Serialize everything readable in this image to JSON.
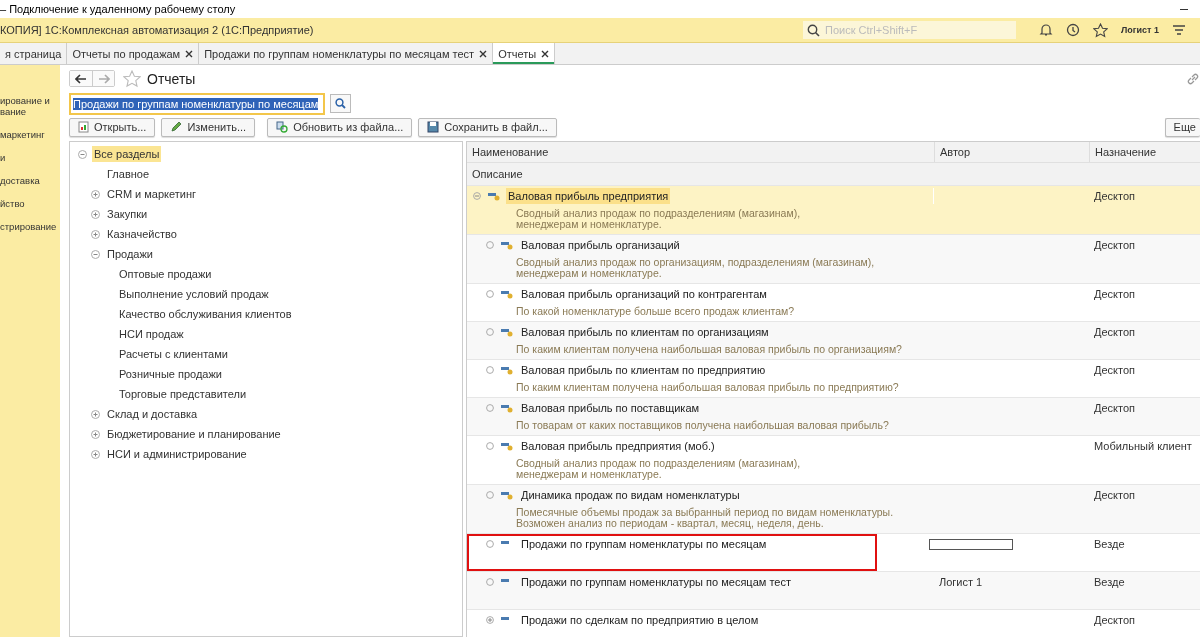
{
  "window": {
    "title": "– Подключение к удаленному рабочему столу"
  },
  "app_bar": {
    "title": "КОПИЯ] 1С:Комплексная автоматизация 2  (1С:Предприятие)",
    "search": {
      "placeholder": "Поиск Ctrl+Shift+F"
    },
    "user": "Логист 1"
  },
  "tabs": [
    {
      "label": "я страница",
      "selected": false,
      "closable": false
    },
    {
      "label": "Отчеты по продажам",
      "selected": false,
      "closable": true
    },
    {
      "label": "Продажи по группам номенклатуры по месяцам тест",
      "selected": false,
      "closable": true
    },
    {
      "label": "Отчеты",
      "selected": true,
      "closable": true
    }
  ],
  "sidebar": {
    "items": [
      "ирование и\nвание",
      "маркетинг",
      "и",
      "доставка",
      "йство",
      "стрирование"
    ]
  },
  "form": {
    "title": "Отчеты",
    "search": {
      "value": "Продажи по группам номенклатуры по месяцам"
    },
    "buttons": [
      {
        "label": "Открыть...",
        "kind": "open"
      },
      {
        "label": "Изменить...",
        "kind": "edit"
      },
      {
        "label": "Обновить из файла...",
        "kind": "update"
      },
      {
        "label": "Сохранить в файл...",
        "kind": "save"
      }
    ],
    "more_button": "Еще"
  },
  "tree": [
    {
      "label": "Все разделы",
      "selected": true,
      "expanded": true,
      "children": [
        {
          "label": "Главное",
          "selected": false
        },
        {
          "label": "CRM и маркетинг",
          "selected": false,
          "expanded": false
        },
        {
          "label": "Закупки",
          "selected": false,
          "expanded": false
        },
        {
          "label": "Казначейство",
          "selected": false,
          "expanded": false
        },
        {
          "label": "Продажи",
          "selected": false,
          "expanded": true,
          "children": [
            {
              "label": "Оптовые продажи",
              "selected": false
            },
            {
              "label": "Выполнение условий продаж",
              "selected": false
            },
            {
              "label": "Качество обслуживания клиентов",
              "selected": false
            },
            {
              "label": "НСИ продаж",
              "selected": false
            },
            {
              "label": "Расчеты с клиентами",
              "selected": false
            },
            {
              "label": "Розничные продажи",
              "selected": false
            },
            {
              "label": "Торговые представители",
              "selected": false
            }
          ]
        },
        {
          "label": "Склад и доставка",
          "selected": false,
          "expanded": false
        },
        {
          "label": "Бюджетирование и планирование",
          "selected": false,
          "expanded": false
        },
        {
          "label": "НСИ и администрирование",
          "selected": false,
          "expanded": false
        }
      ]
    }
  ],
  "table": {
    "columns": [
      "Наименование",
      "Автор",
      "Назначение"
    ],
    "subheader": "Описание",
    "rows": [
      {
        "name": "Валовая прибыль предприятия",
        "kind": "report",
        "leaf": false,
        "expanded": true,
        "selected": true,
        "author": "",
        "author_redacted": false,
        "purpose": "Десктоп",
        "description": "Сводный анализ продаж по подразделениям (магазинам),\nменеджерам и номенклатуре.",
        "highlighted": false
      },
      {
        "name": "Валовая прибыль организаций",
        "kind": "report",
        "leaf": true,
        "expanded": false,
        "selected": false,
        "author": "",
        "author_redacted": false,
        "purpose": "Десктоп",
        "description": "Сводный анализ продаж по организациям, подразделениям (магазинам),\nменеджерам и номенклатуре.",
        "highlighted": false
      },
      {
        "name": "Валовая прибыль организаций по контрагентам",
        "kind": "report",
        "leaf": true,
        "expanded": false,
        "selected": false,
        "author": "",
        "author_redacted": false,
        "purpose": "Десктоп",
        "description": "По какой номенклатуре больше всего продаж клиентам?",
        "highlighted": false
      },
      {
        "name": "Валовая прибыль по клиентам по организациям",
        "kind": "report",
        "leaf": true,
        "expanded": false,
        "selected": false,
        "author": "",
        "author_redacted": false,
        "purpose": "Десктоп",
        "description": "По каким клиентам получена наибольшая валовая прибыль по организациям?",
        "highlighted": false
      },
      {
        "name": "Валовая прибыль по клиентам по предприятию",
        "kind": "report",
        "leaf": true,
        "expanded": false,
        "selected": false,
        "author": "",
        "author_redacted": false,
        "purpose": "Десктоп",
        "description": "По каким клиентам получена наибольшая валовая прибыль по предприятию?",
        "highlighted": false
      },
      {
        "name": "Валовая прибыль по поставщикам",
        "kind": "report",
        "leaf": true,
        "expanded": false,
        "selected": false,
        "author": "",
        "author_redacted": false,
        "purpose": "Десктоп",
        "description": "По товарам от каких поставщиков получена наибольшая валовая прибыль?",
        "highlighted": false
      },
      {
        "name": "Валовая прибыль предприятия (моб.)",
        "kind": "report",
        "leaf": true,
        "expanded": false,
        "selected": false,
        "author": "",
        "author_redacted": false,
        "purpose": "Мобильный клиент",
        "description": "Сводный анализ продаж по подразделениям (магазинам),\nменеджерам и номенклатуре.",
        "highlighted": false
      },
      {
        "name": "Динамика продаж по видам номенклатуры",
        "kind": "report",
        "leaf": true,
        "expanded": false,
        "selected": false,
        "author": "",
        "author_redacted": false,
        "purpose": "Десктоп",
        "description": "Помесячные объемы продаж за выбранный период по видам номенклатуры.\nВозможен анализ по периодам - квартал, месяц, неделя, день.",
        "highlighted": false
      },
      {
        "name": "Продажи по группам номенклатуры по месяцам",
        "kind": "plain",
        "leaf": true,
        "expanded": false,
        "selected": false,
        "author": "",
        "author_redacted": true,
        "purpose": "Везде",
        "description": "",
        "highlighted": true
      },
      {
        "name": "Продажи по группам номенклатуры по месяцам тест",
        "kind": "plain",
        "leaf": true,
        "expanded": false,
        "selected": false,
        "author": "Логист 1",
        "author_redacted": false,
        "purpose": "Везде",
        "description": "",
        "highlighted": false
      },
      {
        "name": "Продажи по сделкам по предприятию в целом",
        "kind": "plain",
        "leaf": false,
        "expanded": false,
        "selected": false,
        "author": "",
        "author_redacted": false,
        "purpose": "Десктоп",
        "description": "",
        "highlighted": false
      }
    ]
  }
}
